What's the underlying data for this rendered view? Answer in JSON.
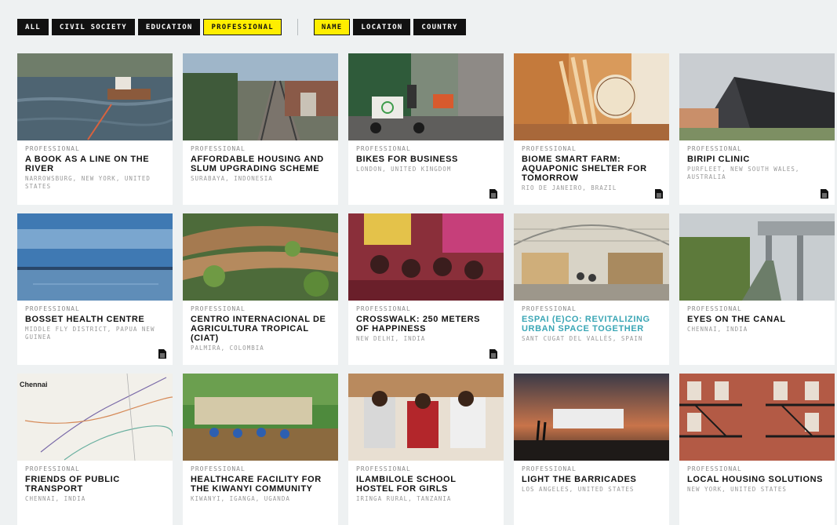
{
  "filters": {
    "category": [
      "ALL",
      "CIVIL SOCIETY",
      "EDUCATION",
      "PROFESSIONAL"
    ],
    "active_category": "PROFESSIONAL",
    "sort": [
      "NAME",
      "LOCATION",
      "COUNTRY"
    ],
    "active_sort": "NAME"
  },
  "projects": [
    {
      "category": "PROFESSIONAL",
      "title": "A BOOK AS A LINE ON THE RIVER",
      "location": "NARROWSBURG, NEW YORK, UNITED STATES",
      "doc": false,
      "thumb": "river-floating-desk"
    },
    {
      "category": "PROFESSIONAL",
      "title": "AFFORDABLE HOUSING AND SLUM UPGRADING SCHEME",
      "location": "SURABAYA, INDONESIA",
      "doc": false,
      "thumb": "railway-houses"
    },
    {
      "category": "PROFESSIONAL",
      "title": "BIKES FOR BUSINESS",
      "location": "LONDON, UNITED KINGDOM",
      "doc": true,
      "thumb": "cargo-bikes-street"
    },
    {
      "category": "PROFESSIONAL",
      "title": "BIOME SMART FARM: AQUAPONIC SHELTER FOR TOMORROW",
      "location": "RIO DE JANEIRO, BRAZIL",
      "doc": true,
      "thumb": "wooden-interior"
    },
    {
      "category": "PROFESSIONAL",
      "title": "BIRIPI CLINIC",
      "location": "PURFLEET, NEW SOUTH WALES, AUSTRALIA",
      "doc": true,
      "thumb": "angular-building"
    },
    {
      "category": "PROFESSIONAL",
      "title": "BOSSET HEALTH CENTRE",
      "location": "MIDDLE FLY DISTRICT, PAPUA NEW GUINEA",
      "doc": true,
      "thumb": "lake-horizon"
    },
    {
      "category": "PROFESSIONAL",
      "title": "CENTRO INTERNACIONAL DE AGRICULTURA TROPICAL (CIAT)",
      "location": "PALMIRA, COLOMBIA",
      "doc": false,
      "thumb": "green-roof"
    },
    {
      "category": "PROFESSIONAL",
      "title": "CROSSWALK: 250 METERS OF HAPPINESS",
      "location": "NEW DELHI, INDIA",
      "doc": true,
      "thumb": "crowd-children"
    },
    {
      "category": "PROFESSIONAL",
      "title": "ESPAI (E)CO: REVITALIZING URBAN SPACE TOGETHER",
      "location": "SANT CUGAT DEL VALLÈS, SPAIN",
      "doc": false,
      "highlight": true,
      "thumb": "greenhouse-interior"
    },
    {
      "category": "PROFESSIONAL",
      "title": "EYES ON THE CANAL",
      "location": "CHENNAI, INDIA",
      "doc": false,
      "thumb": "canal-railway"
    },
    {
      "category": "PROFESSIONAL",
      "title": "FRIENDS OF PUBLIC TRANSPORT",
      "location": "CHENNAI, INDIA",
      "doc": false,
      "thumb": "transport-map",
      "map_title": "Chennai"
    },
    {
      "category": "PROFESSIONAL",
      "title": "HEALTHCARE FACILITY FOR THE KIWANYI COMMUNITY",
      "location": "KIWANYI, IGANGA, UGANDA",
      "doc": false,
      "thumb": "community-gathering"
    },
    {
      "category": "PROFESSIONAL",
      "title": "ILAMBILOLE SCHOOL HOSTEL FOR GIRLS",
      "location": "IRINGA RURAL, TANZANIA",
      "doc": false,
      "thumb": "students-reading"
    },
    {
      "category": "PROFESSIONAL",
      "title": "LIGHT THE BARRICADES",
      "location": "LOS ANGELES, UNITED STATES",
      "doc": false,
      "thumb": "dusk-billboard"
    },
    {
      "category": "PROFESSIONAL",
      "title": "LOCAL HOUSING SOLUTIONS",
      "location": "NEW YORK, UNITED STATES",
      "doc": false,
      "thumb": "fire-escapes"
    }
  ]
}
